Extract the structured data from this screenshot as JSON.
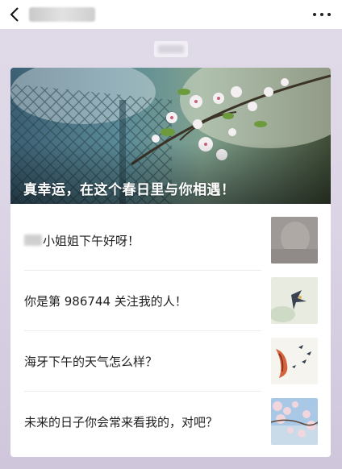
{
  "header": {
    "back_icon": "chevron-left-icon",
    "more_icon": "more-dots-icon"
  },
  "article": {
    "hero_title": "真幸运，在这个春日里与你相遇！",
    "items": [
      {
        "text_visible": "小姐姐下午好呀！"
      },
      {
        "text": "你是第 986744 关注我的人！"
      },
      {
        "text": "海牙下午的天气怎么样？"
      },
      {
        "text": "未来的日子你会常来看我的，对吧？"
      }
    ]
  }
}
